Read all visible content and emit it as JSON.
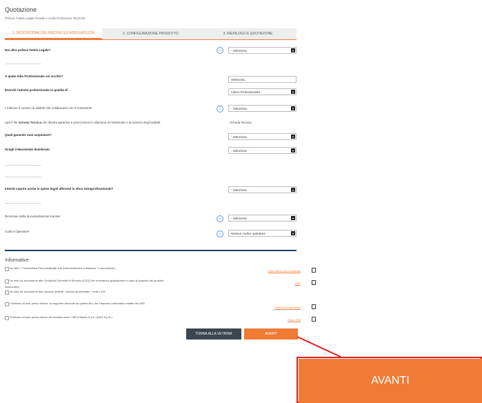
{
  "page": {
    "title": "Quotazione",
    "subtitle": "Polizza Tutela Legale Penale e Civile Professioni Tecniche"
  },
  "tabs": [
    {
      "label": "1. DESCRIZIONE DEL RISCHIO ED ADEGUATEZZA"
    },
    {
      "label": "2. CONFIGURAZIONE PRODOTTO"
    },
    {
      "label": "3. RIEPILOGO E QUOTAZIONE"
    }
  ],
  "form": {
    "q1": "Hai altra polizza Tutela Legale?",
    "q2": "A quale Albo Professionale sei iscritto?",
    "q3": "Eserciti l'attività professionale in qualità di",
    "q4": "• Indicare il numero di addetti che collaborano con il Contraente",
    "q5_prefix": "Apri il file",
    "q5_link": "Scheda Tecnica",
    "q5_suffix": "che illustra garanzie e premi annui in relazione al massimale e al numero degli addetti",
    "q6": "Quali garanzie vuoi acquistare?",
    "q7": "Scegli il Massimale desiderato",
    "q8": "Intendi coprire anche le spese legali afferenti la sfera extraprofessionale?",
    "q9": "Ricezione della documentazione tramite:",
    "q10": "Codice Operatore",
    "dashes": "----------------------------------------------------",
    "sel_default": "- Seleziona -",
    "albo_value": "Seleziona..",
    "qualita_value": "Libero Professionista",
    "scheda_tecnica": "Scheda Tecnica",
    "codice_value": "Nessun codice operatore"
  },
  "informative": {
    "title": "Informative",
    "items": [
      {
        "text": "Ho letto \" l' Informativa Precontrattuale sull' Intermediazione a distanza \" e acconsento.",
        "link": "Informativa precontrattuale"
      },
      {
        "text": "Ho letto ed acconsento alle Condizioni Generali di Servizio (CGS) che troveranno applicazione in caso di acquisto del prodotto",
        "text2": "assicurativo.",
        "link": "CGS"
      },
      {
        "text": "Ho letto ed acconsento alle clausole definite \" Articoli da accettare \" nelle CGS."
      },
      {
        "text": "Confermo di aver preso visione, su supporto durevole su questo sito, del Fascicolo Informativo redatto da DAS",
        "link": "Fascicolo Informativo"
      },
      {
        "text": "Confermo di aver preso visione del modello unico 7AB di Marsh S.p.A. (DAS S.p.A.)",
        "link": "Unico 7AB"
      }
    ]
  },
  "buttons": {
    "back": "TORNA ALLA VETRINA",
    "next": "AVANTI",
    "zoom_next": "AVANTI"
  },
  "colors": {
    "accent": "#ef7b35",
    "dark": "#3b464f",
    "navy": "#1d3b63",
    "highlight": "#e01b1b"
  }
}
